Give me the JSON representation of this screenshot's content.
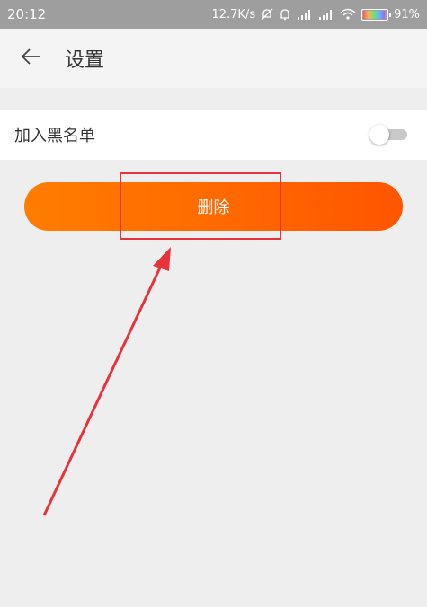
{
  "status_bar": {
    "time": "20:12",
    "speed": "12.7K/s",
    "battery": "91%",
    "icons": [
      "mute-icon",
      "alarm-icon",
      "signal-icon",
      "signal-icon",
      "wifi-icon",
      "battery-icon"
    ],
    "battery_level": 0.91
  },
  "header": {
    "back_icon": "arrow-left-icon",
    "title": "设置"
  },
  "settings": {
    "blacklist_label": "加入黑名单",
    "blacklist_enabled": false
  },
  "actions": {
    "delete_label": "删除"
  },
  "colors": {
    "accent_start": "#ff7d00",
    "accent_end": "#ff5500",
    "annotation": "#e8323c",
    "statusbar": "#9e9e9e"
  }
}
